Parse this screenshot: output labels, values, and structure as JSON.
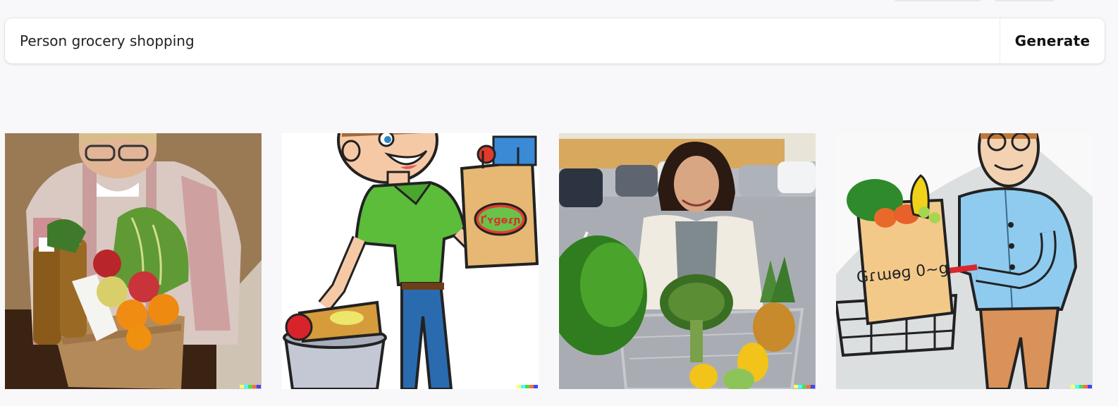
{
  "search": {
    "value": "Person grocery shopping",
    "generate_label": "Generate"
  },
  "results": [
    {
      "style": "photo",
      "subject": "man carrying paper grocery bag of produce"
    },
    {
      "style": "cartoon",
      "subject": "cartoon man in green shirt holding grocery bag"
    },
    {
      "style": "photo",
      "subject": "woman pushing cart of vegetables in parking lot"
    },
    {
      "style": "sketch",
      "subject": "illustrated man in blue shirt with grocery bag and cart"
    }
  ],
  "bag_text": {
    "tile2": "Ґʏɡɵɾɲ",
    "tile4": "Gɾɯɵɡ 0~g"
  },
  "watermark_colors": [
    "#ffff66",
    "#42ffff",
    "#51da4c",
    "#ff6e3c",
    "#3c46ff"
  ]
}
